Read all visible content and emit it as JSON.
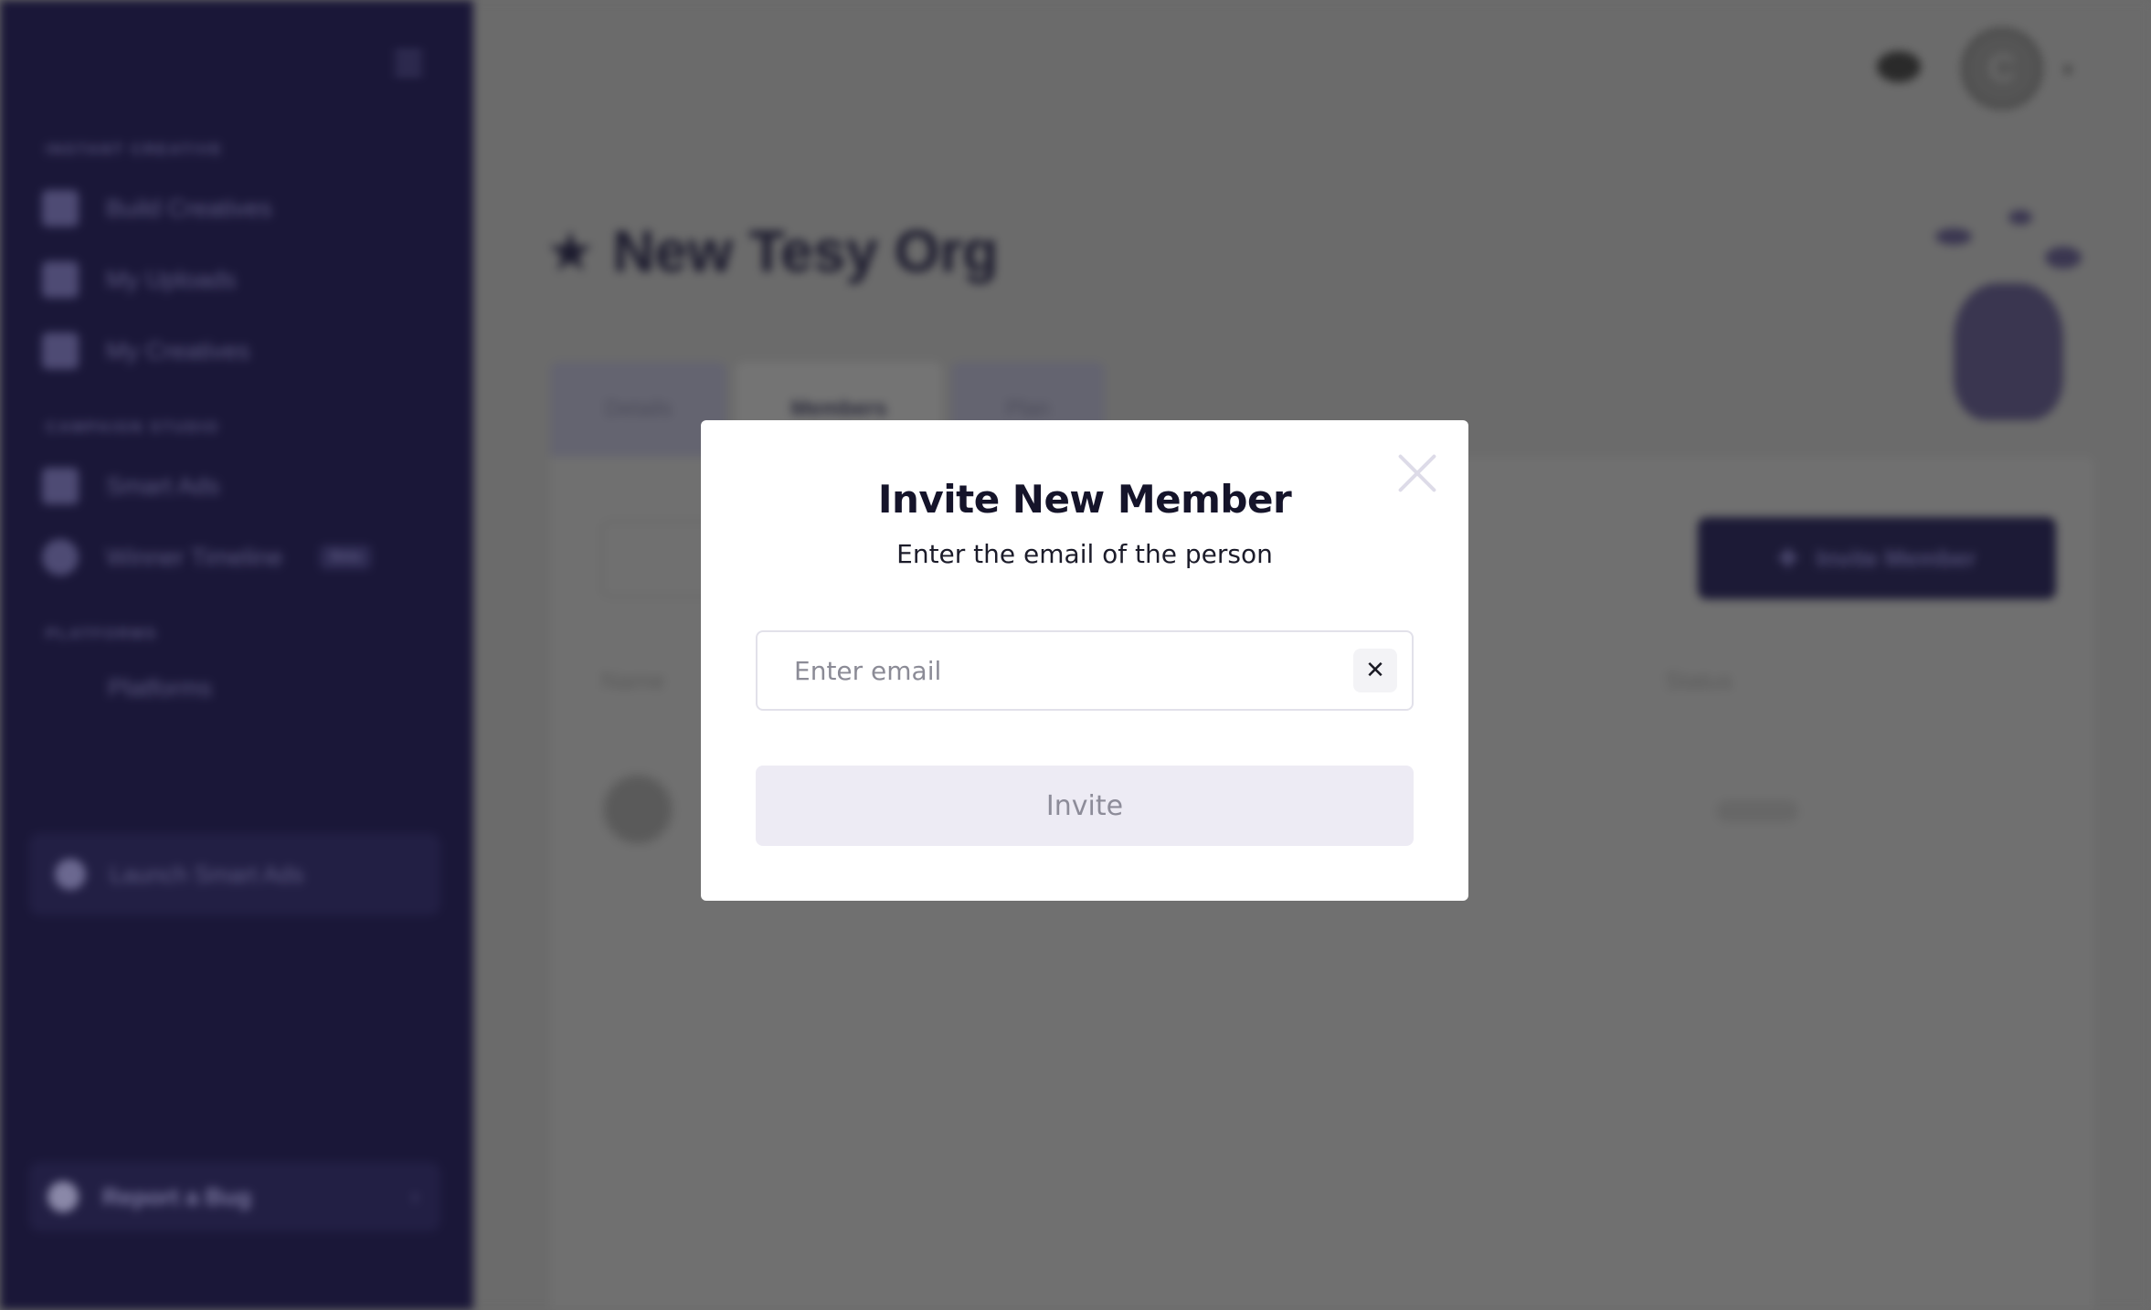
{
  "sidebar": {
    "sections": [
      "INSTANT CREATIVE",
      "CAMPAIGN STUDIO",
      "PLATFORMS"
    ],
    "items": [
      {
        "label": "Build Creatives",
        "icon": "grid-icon"
      },
      {
        "label": "My Uploads",
        "icon": "folder-icon"
      },
      {
        "label": "My Creatives",
        "icon": "brush-icon"
      },
      {
        "label": "Smart Ads",
        "icon": "megaphone-icon"
      },
      {
        "label": "Winner Timeline",
        "icon": "clock-icon",
        "badge": "Beta"
      },
      {
        "label": "Platforms",
        "icon": ""
      }
    ],
    "launch_label": "Launch Smart Ads",
    "bug_label": "Report a Bug"
  },
  "header": {
    "avatar_initial": "C"
  },
  "org": {
    "title": "New Tesy Org",
    "tabs": [
      "Details",
      "Members",
      "Plan"
    ],
    "invite_button_label": "Invite Member",
    "columns": [
      "Name",
      "Status"
    ]
  },
  "modal": {
    "title": "Invite New Member",
    "subtitle": "Enter the email of the person",
    "email_placeholder": "Enter email",
    "clear_symbol": "✕",
    "invite_label": "Invite"
  }
}
